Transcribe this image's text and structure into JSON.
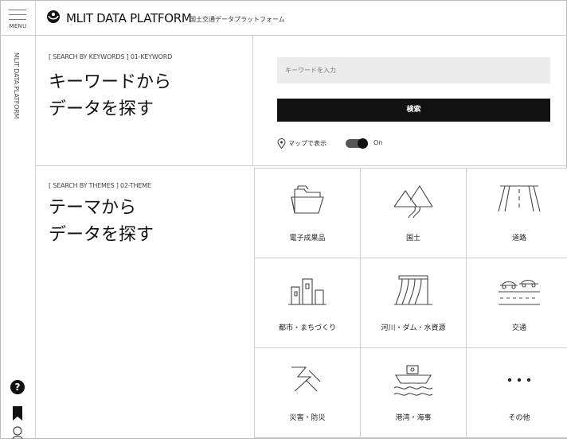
{
  "rail": {
    "menu_label": "MENU",
    "brand_vertical": "MLIT DATA PLATFORM",
    "help_glyph": "?"
  },
  "header": {
    "title": "MLIT DATA PLATFORM",
    "subtitle": "国土交通データプラットフォーム"
  },
  "keyword_search": {
    "tag": "[ SEARCH BY KEYWORDS ] 01-KEYWORD",
    "title_line1": "キーワードから",
    "title_line2": "データを探す",
    "input_placeholder": "キーワードを入力",
    "button_label": "検索",
    "map_label": "マップで表示",
    "toggle_state_label": "On"
  },
  "theme_search": {
    "tag": "[ SEARCH BY THEMES ] 02-THEME",
    "title_line1": "テーマから",
    "title_line2": "データを探す",
    "tiles": [
      {
        "label": "電子成果品",
        "icon": "folder-icon"
      },
      {
        "label": "国土",
        "icon": "mountain-icon"
      },
      {
        "label": "道路",
        "icon": "road-icon"
      },
      {
        "label": "都市・まちづくり",
        "icon": "city-buildings-icon"
      },
      {
        "label": "河川・ダム・水資源",
        "icon": "dam-icon"
      },
      {
        "label": "交通",
        "icon": "traffic-icon"
      },
      {
        "label": "災害・防災",
        "icon": "disaster-icon"
      },
      {
        "label": "港湾・海事",
        "icon": "ship-icon"
      },
      {
        "label": "その他",
        "icon": "more-dots-icon"
      }
    ]
  }
}
